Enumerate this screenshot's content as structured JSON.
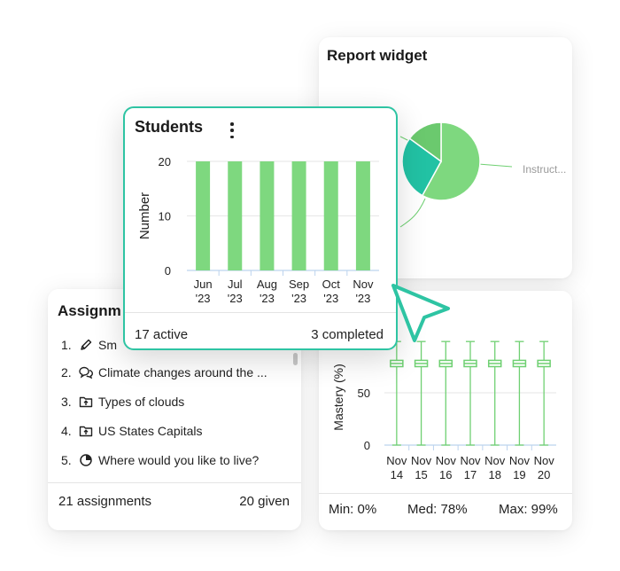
{
  "report_widget": {
    "title": "Report widget",
    "pie_label": "Instruct...",
    "colors": {
      "slice_main": "#7ed87f",
      "slice_teal": "#22c2a4",
      "slice_small": "#6bc96e",
      "leader": "#6fd072"
    }
  },
  "mastery": {
    "min_label": "Min: 0%",
    "med_label": "Med: 78%",
    "max_label": "Max: 99%"
  },
  "assignments": {
    "title": "Assignm",
    "items": [
      {
        "num": "1.",
        "icon": "pencil-icon",
        "text": "Sm"
      },
      {
        "num": "2.",
        "icon": "chat-bubbles-icon",
        "text": "Climate changes around the ..."
      },
      {
        "num": "3.",
        "icon": "folder-upload-icon",
        "text": "Types of clouds"
      },
      {
        "num": "4.",
        "icon": "folder-upload-icon",
        "text": "US States Capitals"
      },
      {
        "num": "5.",
        "icon": "pie-chart-icon",
        "text": "Where would you like to live?"
      }
    ],
    "count_label": "21 assignments",
    "given_label": "20 given"
  },
  "students": {
    "title": "Students",
    "menu_icon": "kebab-menu-icon",
    "active_label": "17 active",
    "completed_label": "3 completed"
  },
  "chart_data": [
    {
      "type": "bar",
      "title": "Students",
      "ylabel": "Number",
      "xlabel": "",
      "categories": [
        [
          "Jun",
          "'23"
        ],
        [
          "Jul",
          "'23"
        ],
        [
          "Aug",
          "'23"
        ],
        [
          "Sep",
          "'23"
        ],
        [
          "Oct",
          "'23"
        ],
        [
          "Nov",
          "'23"
        ]
      ],
      "values": [
        20,
        20,
        20,
        20,
        20,
        20
      ],
      "ylim": [
        0,
        20
      ],
      "yticks": [
        0,
        10,
        20
      ],
      "grid": true,
      "color": "#7ed87f"
    },
    {
      "type": "box",
      "ylabel": "Mastery (%)",
      "xlabel": "",
      "categories": [
        [
          "Nov",
          "14"
        ],
        [
          "Nov",
          "15"
        ],
        [
          "Nov",
          "16"
        ],
        [
          "Nov",
          "17"
        ],
        [
          "Nov",
          "18"
        ],
        [
          "Nov",
          "19"
        ],
        [
          "Nov",
          "20"
        ]
      ],
      "series": [
        {
          "min": 0,
          "q1": 75,
          "median": 78,
          "q3": 81,
          "max": 99
        },
        {
          "min": 0,
          "q1": 75,
          "median": 78,
          "q3": 81,
          "max": 99
        },
        {
          "min": 0,
          "q1": 75,
          "median": 78,
          "q3": 81,
          "max": 99
        },
        {
          "min": 0,
          "q1": 75,
          "median": 78,
          "q3": 81,
          "max": 99
        },
        {
          "min": 0,
          "q1": 75,
          "median": 78,
          "q3": 81,
          "max": 99
        },
        {
          "min": 0,
          "q1": 75,
          "median": 78,
          "q3": 81,
          "max": 99
        },
        {
          "min": 0,
          "q1": 75,
          "median": 78,
          "q3": 81,
          "max": 99
        }
      ],
      "ylim": [
        0,
        100
      ],
      "yticks": [
        0,
        50
      ],
      "grid": true,
      "color": "#6fd072"
    },
    {
      "type": "pie",
      "values": [
        58,
        27,
        15
      ],
      "colors": [
        "#7ed87f",
        "#22c2a4",
        "#6bc96e"
      ],
      "legend": "none"
    }
  ]
}
